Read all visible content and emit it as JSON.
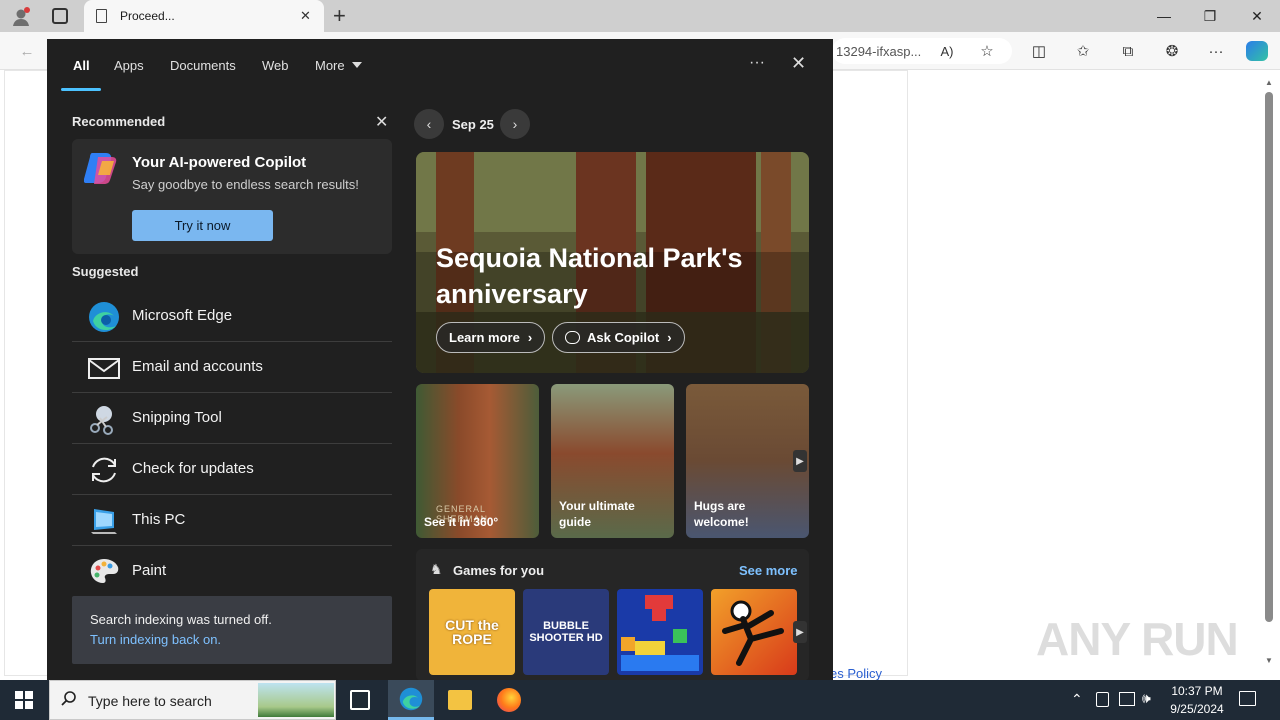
{
  "browser": {
    "tab_title": "Proceed...",
    "address_text": "13294-ifxasp...",
    "new_tab": "+",
    "minimize": "—",
    "restore": "❐",
    "close": "✕"
  },
  "start": {
    "tabs": [
      "All",
      "Apps",
      "Documents",
      "Web",
      "More"
    ],
    "ellipsis": "···",
    "close": "✕",
    "recommended_title": "Recommended",
    "rec_card": {
      "title": "Your AI-powered Copilot",
      "subtitle": "Say goodbye to endless search results!",
      "button": "Try it now"
    },
    "suggested_title": "Suggested",
    "suggested": [
      {
        "label": "Microsoft Edge",
        "icon": "edge-icon"
      },
      {
        "label": "Email and accounts",
        "icon": "mail-icon"
      },
      {
        "label": "Snipping Tool",
        "icon": "snipping-tool-icon"
      },
      {
        "label": "Check for updates",
        "icon": "refresh-icon"
      },
      {
        "label": "This PC",
        "icon": "computer-icon"
      },
      {
        "label": "Paint",
        "icon": "palette-icon"
      }
    ],
    "index_notice": {
      "text": "Search indexing was turned off.",
      "link": "Turn indexing back on."
    },
    "date": "Sep 25",
    "hero": {
      "title_line1": "Sequoia National Park's",
      "title_line2": "anniversary",
      "learn_more": "Learn more",
      "ask_copilot": "Ask Copilot"
    },
    "tiles": [
      {
        "caption": "See it in 360°",
        "sign": "GENERAL SHERMAN"
      },
      {
        "caption_line1": "Your ultimate",
        "caption_line2": "guide"
      },
      {
        "caption_line1": "Hugs are",
        "caption_line2": "welcome!"
      }
    ],
    "games": {
      "title": "Games for you",
      "see_more": "See more",
      "items": [
        {
          "name": "CUT the ROPE"
        },
        {
          "name": "BUBBLE SHOOTER HD"
        },
        {
          "name": "block puzzle"
        },
        {
          "name": "stickman fighter"
        }
      ]
    }
  },
  "page_footer_text": "es Policy",
  "watermark": "ANY RUN",
  "taskbar": {
    "search_placeholder": "Type here to search",
    "time": "10:37 PM",
    "date": "9/25/2024"
  },
  "colors": {
    "panel_bg": "#202020",
    "accent": "#4cc2ff",
    "button": "#7ab7f0",
    "taskbar": "#1f2a36"
  }
}
